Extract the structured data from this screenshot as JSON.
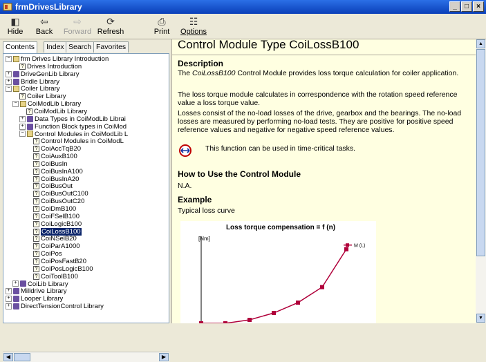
{
  "window": {
    "title": "frmDrivesLibrary",
    "minimize": "_",
    "maximize": "□",
    "close": "×"
  },
  "toolbar": {
    "hide": "Hide",
    "back": "Back",
    "forward": "Forward",
    "refresh": "Refresh",
    "print": "Print",
    "options": "Options"
  },
  "tabs": {
    "contents": "Contents",
    "index": "Index",
    "search": "Search",
    "favorites": "Favorites"
  },
  "tree": [
    {
      "label": "frm Drives Library Introduction",
      "icon": "openbook",
      "exp": "−"
    },
    {
      "label": "Drives Introduction",
      "icon": "page"
    },
    {
      "label": "DriveGenLib Library",
      "icon": "book",
      "exp": "+"
    },
    {
      "label": "Bridle Library",
      "icon": "book",
      "exp": "+"
    },
    {
      "label": "Coiler Library",
      "icon": "openbook",
      "exp": "−"
    },
    {
      "label": "Coiler Library",
      "icon": "page"
    },
    {
      "label": "CoiModLib Library",
      "icon": "openbook",
      "exp": "−"
    },
    {
      "label": "CoiModLib Library",
      "icon": "page"
    },
    {
      "label": "Data Types in CoiModLib Librai",
      "icon": "book",
      "exp": "+"
    },
    {
      "label": "Function Block types in CoiMod",
      "icon": "book",
      "exp": "+"
    },
    {
      "label": "Control Modules in CoiModLib L",
      "icon": "openbook",
      "exp": "−"
    },
    {
      "label": "Control Modules in CoiModL",
      "icon": "page"
    },
    {
      "label": "CoiAccTqB20",
      "icon": "page"
    },
    {
      "label": "CoiAuxB100",
      "icon": "page"
    },
    {
      "label": "CoiBusIn",
      "icon": "page"
    },
    {
      "label": "CoiBusInA100",
      "icon": "page"
    },
    {
      "label": "CoiBusInA20",
      "icon": "page"
    },
    {
      "label": "CoiBusOut",
      "icon": "page"
    },
    {
      "label": "CoiBusOutC100",
      "icon": "page"
    },
    {
      "label": "CoiBusOutC20",
      "icon": "page"
    },
    {
      "label": "CoiDmB100",
      "icon": "page"
    },
    {
      "label": "CoiFSelB100",
      "icon": "page"
    },
    {
      "label": "CoiLogicB100",
      "icon": "page"
    },
    {
      "label": "CoiLossB100",
      "icon": "page",
      "selected": true
    },
    {
      "label": "CoiNSelB20",
      "icon": "page"
    },
    {
      "label": "CoiParA1000",
      "icon": "page"
    },
    {
      "label": "CoiPos",
      "icon": "page"
    },
    {
      "label": "CoiPosFastB20",
      "icon": "page"
    },
    {
      "label": "CoiPosLogicB100",
      "icon": "page"
    },
    {
      "label": "CoiToolB100",
      "icon": "page"
    },
    {
      "label": "CoiLib Library",
      "icon": "book",
      "exp": "+"
    },
    {
      "label": "Milldrive Library",
      "icon": "book",
      "exp": "+"
    },
    {
      "label": "Looper Library",
      "icon": "book",
      "exp": "+"
    },
    {
      "label": "DirectTensionControl Library",
      "icon": "book",
      "exp": "+"
    }
  ],
  "content": {
    "title": "Control Module Type CoiLossB100",
    "description_heading": "Description",
    "desc_italic": "CoiLossB100",
    "desc_p1_pre": "The ",
    "desc_p1_post": " Control Module provides loss torque calculation for coiler application.",
    "desc_p2": "The loss torque module calculates in correspondence with the rotation speed reference value a loss torque value.",
    "desc_p3": "Losses consist of the no-load losses of the drive, gearbox and the bearings. The no-load losses are measured by performing no-load tests. They are positive for positive speed reference values and negative for negative speed reference values.",
    "time_critical": "This function can be used in time-critical tasks.",
    "how_to_heading": "How to Use the Control Module",
    "how_to_text": "N.A.",
    "example_heading": "Example",
    "example_text": "Typical loss curve"
  },
  "chart_data": {
    "type": "line",
    "title": "Loss torque compensation = f (n)",
    "ylabel": "[Nm]",
    "series": [
      {
        "name": "M (L)",
        "x": [
          0,
          1,
          2,
          3,
          4,
          5,
          6
        ],
        "y": [
          0,
          0,
          4,
          12,
          24,
          42,
          86
        ]
      }
    ],
    "legend": "right",
    "color": "#b0003a"
  }
}
